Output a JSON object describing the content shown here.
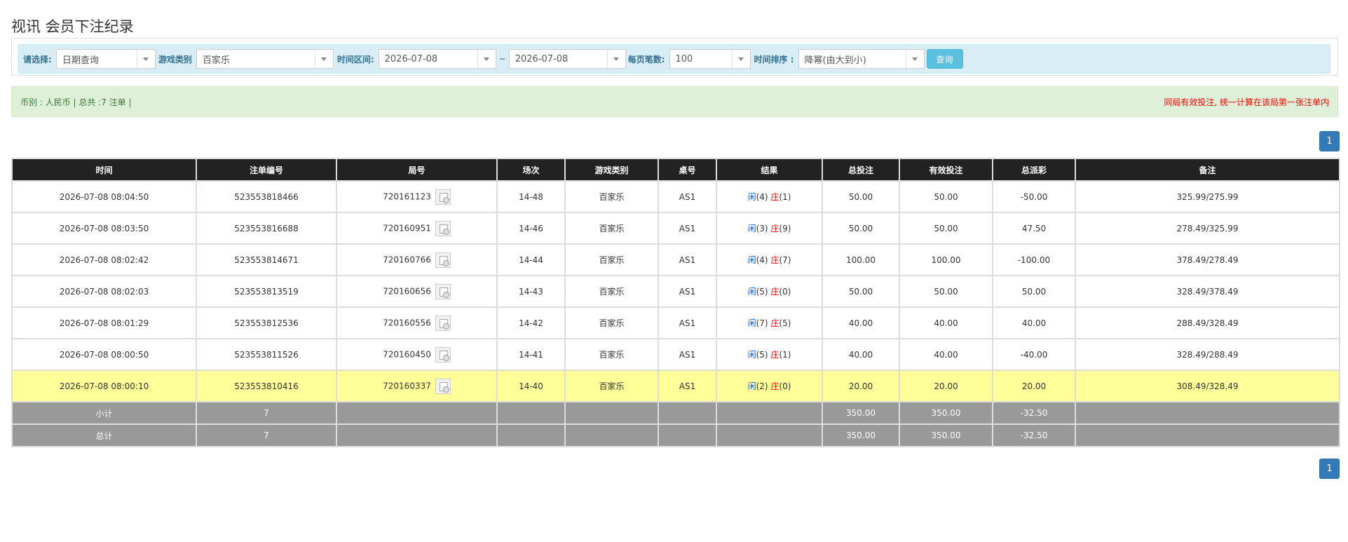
{
  "page_title": "视讯 会员下注纪录",
  "filters": {
    "select_label": "请选择:",
    "select_value": "日期查询",
    "game_type_label": "游戏类别",
    "game_type_value": "百家乐",
    "time_range_label": "时间区间:",
    "date_from": "2026-07-08",
    "tilde": "~",
    "date_to": "2026-07-08",
    "per_page_label": "每页笔数:",
    "per_page_value": "100",
    "sort_label": "时间排序 :",
    "sort_value": "降幂(由大到小)",
    "query_button": "查询"
  },
  "info": {
    "summary": "币别 : 人民币 | 总共 :7 注单 |",
    "notice": "同局有效投注, 统一计算在该局第一张注单内"
  },
  "pagination": {
    "current_page": "1"
  },
  "table": {
    "headers": [
      "时间",
      "注单编号",
      "局号",
      "场次",
      "游戏类别",
      "桌号",
      "结果",
      "总投注",
      "有效投注",
      "总派彩",
      "备注"
    ],
    "rows": [
      {
        "time": "2026-07-08 08:04:50",
        "bet_no": "523553818466",
        "round_no": "720161123",
        "session": "14-48",
        "game": "百家乐",
        "table": "AS1",
        "player_label": "闲",
        "player_score": "(4)",
        "banker_label": "庄",
        "banker_score": "(1)",
        "total_bet": "50.00",
        "valid_bet": "50.00",
        "payout": "-50.00",
        "payout_negative": true,
        "remark": "325.99/275.99"
      },
      {
        "time": "2026-07-08 08:03:50",
        "bet_no": "523553816688",
        "round_no": "720160951",
        "session": "14-46",
        "game": "百家乐",
        "table": "AS1",
        "player_label": "闲",
        "player_score": "(3)",
        "banker_label": "庄",
        "banker_score": "(9)",
        "total_bet": "50.00",
        "valid_bet": "50.00",
        "payout": "47.50",
        "payout_negative": false,
        "remark": "278.49/325.99"
      },
      {
        "time": "2026-07-08 08:02:42",
        "bet_no": "523553814671",
        "round_no": "720160766",
        "session": "14-44",
        "game": "百家乐",
        "table": "AS1",
        "player_label": "闲",
        "player_score": "(4)",
        "banker_label": "庄",
        "banker_score": "(7)",
        "total_bet": "100.00",
        "valid_bet": "100.00",
        "payout": "-100.00",
        "payout_negative": true,
        "remark": "378.49/278.49"
      },
      {
        "time": "2026-07-08 08:02:03",
        "bet_no": "523553813519",
        "round_no": "720160656",
        "session": "14-43",
        "game": "百家乐",
        "table": "AS1",
        "player_label": "闲",
        "player_score": "(5)",
        "banker_label": "庄",
        "banker_score": "(0)",
        "total_bet": "50.00",
        "valid_bet": "50.00",
        "payout": "50.00",
        "payout_negative": false,
        "remark": "328.49/378.49"
      },
      {
        "time": "2026-07-08 08:01:29",
        "bet_no": "523553812536",
        "round_no": "720160556",
        "session": "14-42",
        "game": "百家乐",
        "table": "AS1",
        "player_label": "闲",
        "player_score": "(7)",
        "banker_label": "庄",
        "banker_score": "(5)",
        "total_bet": "40.00",
        "valid_bet": "40.00",
        "payout": "40.00",
        "payout_negative": false,
        "remark": "288.49/328.49"
      },
      {
        "time": "2026-07-08 08:00:50",
        "bet_no": "523553811526",
        "round_no": "720160450",
        "session": "14-41",
        "game": "百家乐",
        "table": "AS1",
        "player_label": "闲",
        "player_score": "(5)",
        "banker_label": "庄",
        "banker_score": "(1)",
        "total_bet": "40.00",
        "valid_bet": "40.00",
        "payout": "-40.00",
        "payout_negative": true,
        "remark": "328.49/288.49"
      },
      {
        "time": "2026-07-08 08:00:10",
        "bet_no": "523553810416",
        "round_no": "720160337",
        "session": "14-40",
        "game": "百家乐",
        "table": "AS1",
        "player_label": "闲",
        "player_score": "(2)",
        "banker_label": "庄",
        "banker_score": "(0)",
        "total_bet": "20.00",
        "valid_bet": "20.00",
        "payout": "20.00",
        "payout_negative": false,
        "remark": "308.49/328.49",
        "highlighted": true
      }
    ],
    "subtotal": {
      "label": "小计",
      "count": "7",
      "total_bet": "350.00",
      "valid_bet": "350.00",
      "payout": "-32.50"
    },
    "grand_total": {
      "label": "总计",
      "count": "7",
      "total_bet": "350.00",
      "valid_bet": "350.00",
      "payout": "-32.50"
    }
  },
  "colors": {
    "player": "#0056ff",
    "banker": "#ff0000",
    "header_bg": "#222222",
    "highlight_row": "#ffff99",
    "summary_bg": "#999999",
    "pager": "#337ab7"
  },
  "icons": {
    "dropdown": "caret-down-icon",
    "result_detail": "result-detail-icon"
  }
}
